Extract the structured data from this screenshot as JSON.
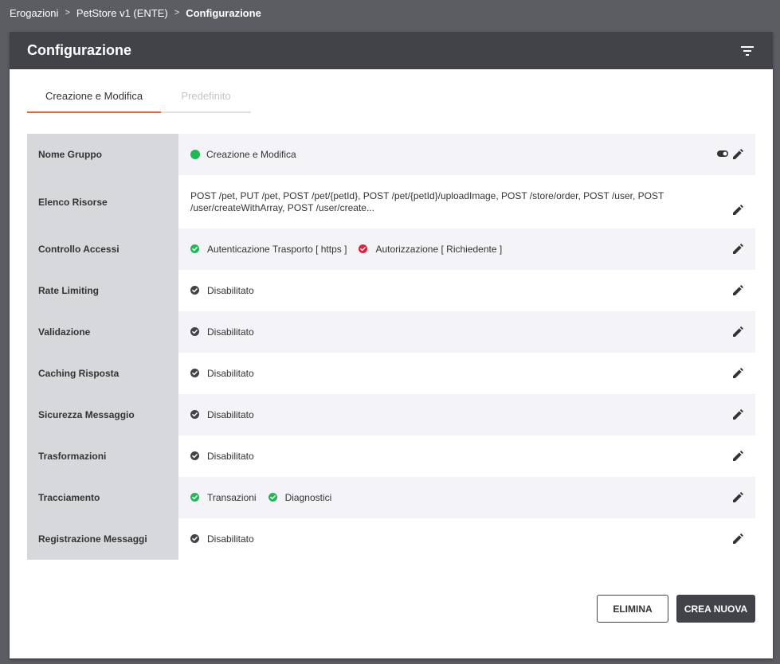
{
  "breadcrumb": {
    "items": [
      "Erogazioni",
      "PetStore v1 (ENTE)"
    ],
    "current": "Configurazione"
  },
  "card": {
    "title": "Configurazione",
    "header_icon": "filter-list-icon"
  },
  "tabs": [
    {
      "label": "Creazione e Modifica",
      "active": true
    },
    {
      "label": "Predefinito",
      "active": false
    }
  ],
  "rows": [
    {
      "label": "Nome Gruppo",
      "value": "Creazione e Modifica",
      "status": "green-dot"
    },
    {
      "label": "Elenco Risorse",
      "value": "POST /pet, PUT /pet, POST /pet/{petId}, POST /pet/{petId}/uploadImage, POST /store/order, POST /user, POST /user/createWithArray, POST /user/create..."
    },
    {
      "label": "Controllo Accessi",
      "items": [
        {
          "text": "Autenticazione Trasporto [ https ]",
          "status": "check-green"
        },
        {
          "text": "Autorizzazione [ Richiedente ]",
          "status": "check-red"
        }
      ]
    },
    {
      "label": "Rate Limiting",
      "value": "Disabilitato",
      "status": "check-dark"
    },
    {
      "label": "Validazione",
      "value": "Disabilitato",
      "status": "check-dark"
    },
    {
      "label": "Caching Risposta",
      "value": "Disabilitato",
      "status": "check-dark"
    },
    {
      "label": "Sicurezza Messaggio",
      "value": "Disabilitato",
      "status": "check-dark"
    },
    {
      "label": "Trasformazioni",
      "value": "Disabilitato",
      "status": "check-dark"
    },
    {
      "label": "Tracciamento",
      "items": [
        {
          "text": "Transazioni",
          "status": "check-green"
        },
        {
          "text": "Diagnostici",
          "status": "check-green"
        }
      ]
    },
    {
      "label": "Registrazione Messaggi",
      "value": "Disabilitato",
      "status": "check-dark"
    }
  ],
  "buttons": {
    "delete": "ELIMINA",
    "create": "CREA NUOVA"
  },
  "colors": {
    "header_bg": "#424348",
    "accent": "#e0663e",
    "green": "#1db954",
    "red": "#e0203a",
    "dark": "#424348"
  }
}
